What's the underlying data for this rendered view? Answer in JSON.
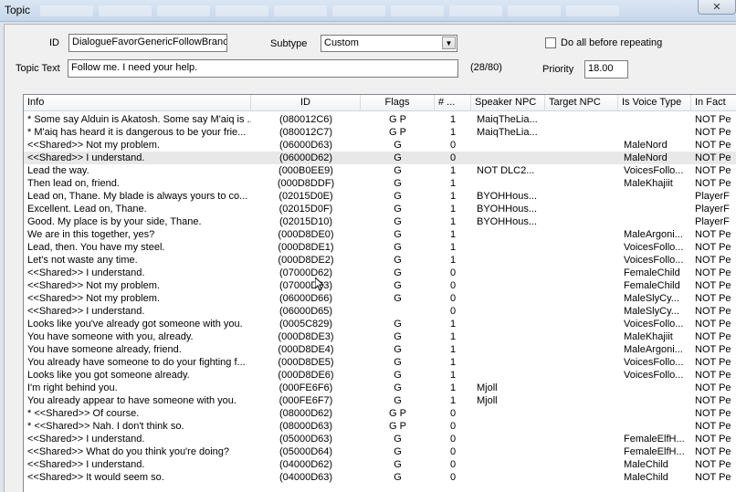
{
  "window": {
    "title": "Topic",
    "close_glyph": "✕"
  },
  "form": {
    "id_label": "ID",
    "id_value": "DialogueFavorGenericFollowBranch",
    "subtype_label": "Subtype",
    "subtype_value": "Custom",
    "do_all_label": "Do all before repeating",
    "topic_text_label": "Topic Text",
    "topic_text_value": "Follow me. I need your help.",
    "char_count": "(28/80)",
    "priority_label": "Priority",
    "priority_value": "18.00"
  },
  "table": {
    "columns": [
      "Info",
      "ID",
      "Flags",
      "# ...",
      "Speaker NPC",
      "Target NPC",
      "Is Voice Type",
      "In Fact"
    ],
    "selected_row": 3,
    "rows": [
      [
        "* Some say Alduin is Akatosh. Some say M'aiq is ...",
        "(080012C6)",
        "G P",
        "1",
        "MaiqTheLia...",
        "",
        "",
        "NOT Pe"
      ],
      [
        "* M'aiq has heard it is dangerous to be your frie...",
        "(080012C7)",
        "G P",
        "1",
        "MaiqTheLia...",
        "",
        "",
        "NOT Pe"
      ],
      [
        "<<Shared>> Not my problem.",
        "(06000D63)",
        "G",
        "0",
        "",
        "",
        "MaleNord",
        "NOT Pe"
      ],
      [
        "<<Shared>> I understand.",
        "(06000D62)",
        "G",
        "0",
        "",
        "",
        "MaleNord",
        "NOT Pe"
      ],
      [
        "Lead the way.",
        "(000B0EE9)",
        "G",
        "1",
        "NOT DLC2...",
        "",
        "VoicesFollo...",
        "NOT Pe"
      ],
      [
        "Then lead on, friend.",
        "(000D8DDF)",
        "G",
        "1",
        "",
        "",
        "MaleKhajiit",
        "NOT Pe"
      ],
      [
        "Lead on, Thane. My blade is always yours to co...",
        "(02015D0E)",
        "G",
        "1",
        "BYOHHous...",
        "",
        "",
        "PlayerF"
      ],
      [
        "Excellent. Lead on, Thane.",
        "(02015D0F)",
        "G",
        "1",
        "BYOHHous...",
        "",
        "",
        "PlayerF"
      ],
      [
        "Good. My place is by your side, Thane.",
        "(02015D10)",
        "G",
        "1",
        "BYOHHous...",
        "",
        "",
        "PlayerF"
      ],
      [
        "We are in this together, yes?",
        "(000D8DE0)",
        "G",
        "1",
        "",
        "",
        "MaleArgoni...",
        "NOT Pe"
      ],
      [
        "Lead, then. You have my steel.",
        "(000D8DE1)",
        "G",
        "1",
        "",
        "",
        "VoicesFollo...",
        "NOT Pe"
      ],
      [
        "Let's not waste any time.",
        "(000D8DE2)",
        "G",
        "1",
        "",
        "",
        "VoicesFollo...",
        "NOT Pe"
      ],
      [
        "<<Shared>> I understand.",
        "(07000D62)",
        "G",
        "0",
        "",
        "",
        "FemaleChild",
        "NOT Pe"
      ],
      [
        "<<Shared>> Not my problem.",
        "(07000D63)",
        "G",
        "0",
        "",
        "",
        "FemaleChild",
        "NOT Pe"
      ],
      [
        "<<Shared>> Not my problem.",
        "(06000D66)",
        "G",
        "0",
        "",
        "",
        "MaleSlyCy...",
        "NOT Pe"
      ],
      [
        "<<Shared>> I understand.",
        "(06000D65)",
        "",
        "0",
        "",
        "",
        "MaleSlyCy...",
        "NOT Pe"
      ],
      [
        "Looks like you've already got someone with you.",
        "(0005C829)",
        "G",
        "1",
        "",
        "",
        "VoicesFollo...",
        "NOT Pe"
      ],
      [
        "You have someone with you, already.",
        "(000D8DE3)",
        "G",
        "1",
        "",
        "",
        "MaleKhajiit",
        "NOT Pe"
      ],
      [
        "You have someone already, friend.",
        "(000D8DE4)",
        "G",
        "1",
        "",
        "",
        "MaleArgoni...",
        "NOT Pe"
      ],
      [
        "You already have someone to do your fighting f...",
        "(000D8DE5)",
        "G",
        "1",
        "",
        "",
        "VoicesFollo...",
        "NOT Pe"
      ],
      [
        "Looks like you got someone already.",
        "(000D8DE6)",
        "G",
        "1",
        "",
        "",
        "VoicesFollo...",
        "NOT Pe"
      ],
      [
        "I'm right behind you.",
        "(000FE6F6)",
        "G",
        "1",
        "Mjoll",
        "",
        "",
        "NOT Pe"
      ],
      [
        "You already appear to have someone with you.",
        "(000FE6F7)",
        "G",
        "1",
        "Mjoll",
        "",
        "",
        "NOT Pe"
      ],
      [
        "* <<Shared>> Of course.",
        "(08000D62)",
        "G P",
        "0",
        "",
        "",
        "",
        "NOT Pe"
      ],
      [
        "* <<Shared>> Nah. I don't think so.",
        "(08000D63)",
        "G P",
        "0",
        "",
        "",
        "",
        "NOT Pe"
      ],
      [
        "<<Shared>> I understand.",
        "(05000D63)",
        "G",
        "0",
        "",
        "",
        "FemaleElfH...",
        "NOT Pe"
      ],
      [
        "<<Shared>> What do you think you're doing?",
        "(05000D64)",
        "G",
        "0",
        "",
        "",
        "FemaleElfH...",
        "NOT Pe"
      ],
      [
        "<<Shared>> I understand.",
        "(04000D62)",
        "G",
        "0",
        "",
        "",
        "MaleChild",
        "NOT Pe"
      ],
      [
        "<<Shared>> It would seem so.",
        "(04000D63)",
        "G",
        "0",
        "",
        "",
        "MaleChild",
        "NOT Pe"
      ]
    ]
  }
}
